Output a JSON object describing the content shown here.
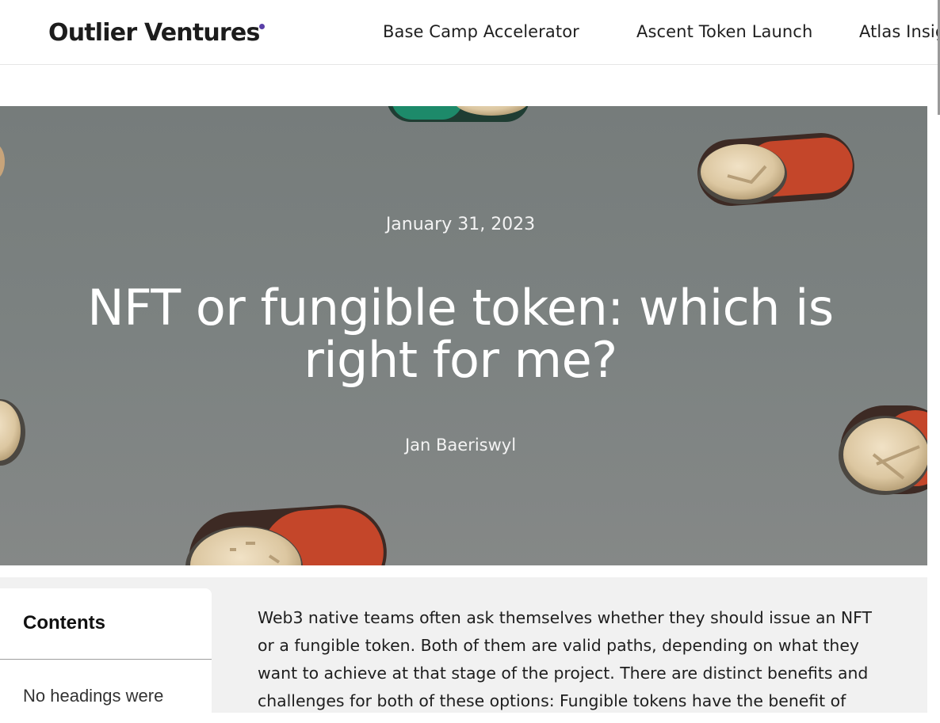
{
  "header": {
    "logo_text": "Outlier Ventures",
    "accent_color": "#5a3fa8",
    "nav": [
      {
        "label": "Base Camp Accelerator"
      },
      {
        "label": "Ascent Token Launch"
      },
      {
        "label": "Atlas Insig"
      }
    ]
  },
  "hero": {
    "date": "January 31, 2023",
    "title": "NFT or fungible token: which is right for me?",
    "author": "Jan Baeriswyl",
    "background_description_icons": [
      "coin-toggle-icon"
    ]
  },
  "toc": {
    "title": "Contents",
    "empty_text": "No headings were"
  },
  "article": {
    "intro": "Web3 native teams often ask themselves whether they should issue an NFT or a fungible token. Both of them are valid paths, depending on what they want to achieve at that stage of the project. There are distinct benefits and challenges for both of these options: Fungible tokens have the benefit of"
  }
}
